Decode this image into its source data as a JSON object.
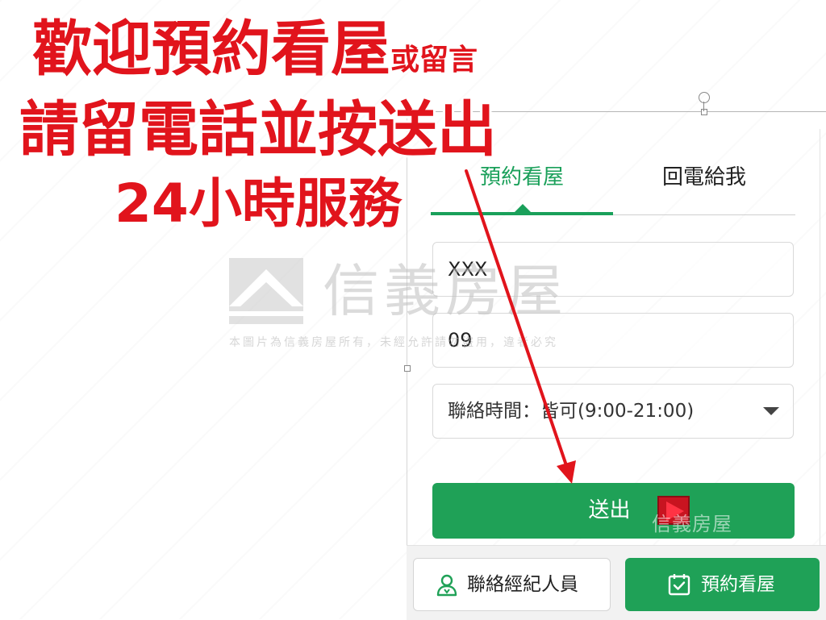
{
  "promo": {
    "line1_big": "歡迎預約看屋",
    "line1_small": "或留言",
    "line2": "請留電話並按送出",
    "line3": "24小時服務"
  },
  "tabs": [
    {
      "label": "預約看屋",
      "active": true
    },
    {
      "label": "回電給我",
      "active": false
    }
  ],
  "form": {
    "name_value": "XXX",
    "phone_value": "09",
    "contact_time_selected": "聯絡時間：皆可(9:00-21:00)",
    "submit_label": "送出"
  },
  "bottom_bar": {
    "contact_agent_label": "聯絡經紀人員",
    "book_viewing_label": "預約看屋"
  },
  "watermark": {
    "brand": "信義房屋",
    "notice": "本圖片為信義房屋所有，未經允許請勿盜用，違者必究",
    "submit_overlay": "信義房屋"
  },
  "icons": {
    "agent": "person-icon",
    "calendar": "calendar-check-icon",
    "dropdown": "caret-down-icon",
    "play": "play-icon"
  },
  "colors": {
    "accent_green": "#1fa157",
    "promo_red": "#e1141c",
    "arrow_red": "#e1141c"
  }
}
